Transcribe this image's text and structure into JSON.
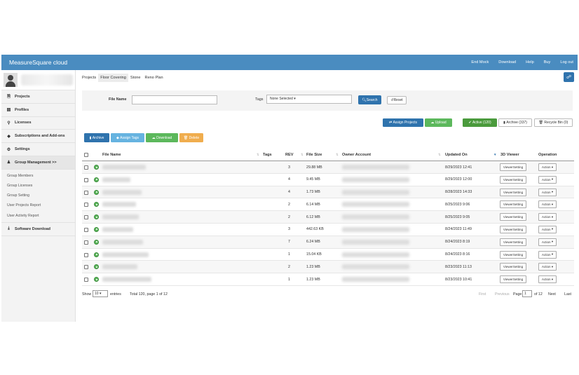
{
  "topbar": {
    "brand": "MeasureSquare cloud",
    "nav": [
      "End Mock",
      "Download",
      "Help",
      "Buy",
      "Log out"
    ]
  },
  "sidebar": {
    "items": [
      {
        "label": "Projects",
        "icon": "file-icon"
      },
      {
        "label": "Profiles",
        "icon": "book-icon"
      },
      {
        "label": "Licenses",
        "icon": "key-icon"
      },
      {
        "label": "Subscriptions and Add-ons",
        "icon": "tag-icon"
      },
      {
        "label": "Settings",
        "icon": "gear-icon"
      },
      {
        "label": "Group Management >>",
        "icon": "users-icon"
      }
    ],
    "group_items": [
      "Group Members",
      "Group Licenses",
      "Group Setting",
      "User Projects Report",
      "User Activity Report"
    ],
    "download_label": "Software Download"
  },
  "project_tabs": {
    "label": "Projects",
    "tabs": [
      "Floor Covering",
      "Stone",
      "Reno Plan"
    ]
  },
  "search": {
    "file_name_label": "File Name",
    "file_name_value": "",
    "tags_label": "Tags",
    "tags_value": "None Selected",
    "search_label": "Search",
    "reset_label": "Reset"
  },
  "actions": {
    "assign_projects": "Assign Projects",
    "upload": "Upload",
    "active": "Active (120)",
    "archive_count": "Archive (337)",
    "recycle": "Recycle Bin (0)",
    "archive": "Archive",
    "assign_tags": "Assign Tags",
    "download": "Download",
    "delete": "Delete"
  },
  "table": {
    "headers": {
      "file_name": "File Name",
      "tags": "Tags",
      "rev": "REV",
      "file_size": "File Size",
      "owner": "Owner Account",
      "updated": "Updated On",
      "viewer": "3D Viewer",
      "operation": "Operation"
    },
    "viewer_label": "ViewerSetting",
    "action_label": "Action",
    "rows": [
      {
        "rev": "3",
        "size": "29.88 MB",
        "updated": "8/29/2023 12:41"
      },
      {
        "rev": "4",
        "size": "9.45 MB",
        "updated": "8/29/2023 12:00"
      },
      {
        "rev": "4",
        "size": "1.73 MB",
        "updated": "8/28/2023 14:33"
      },
      {
        "rev": "2",
        "size": "6.14 MB",
        "updated": "8/25/2023 9:06"
      },
      {
        "rev": "2",
        "size": "6.12 MB",
        "updated": "8/25/2023 9:05"
      },
      {
        "rev": "3",
        "size": "442.63 KB",
        "updated": "8/24/2023 11:49"
      },
      {
        "rev": "7",
        "size": "6.24 MB",
        "updated": "8/24/2023 8:19"
      },
      {
        "rev": "1",
        "size": "15.04 KB",
        "updated": "8/24/2023 8:16"
      },
      {
        "rev": "2",
        "size": "1.23 MB",
        "updated": "8/23/2023 11:13"
      },
      {
        "rev": "1",
        "size": "1.23 MB",
        "updated": "8/23/2023 10:41"
      }
    ]
  },
  "footer": {
    "show": "Show",
    "page_length": "10",
    "entries": "entries",
    "total": "Total 120, page 1 of 12",
    "first": "First",
    "previous": "Previous",
    "page": "Page",
    "page_value": "1",
    "of": "of 12",
    "next": "Next",
    "last": "Last"
  },
  "colors": {
    "topbar": "#4a8cc0",
    "primary": "#2f73ad",
    "success": "#5cb85c",
    "warning": "#f0ad4e",
    "info": "#66b3e0"
  }
}
